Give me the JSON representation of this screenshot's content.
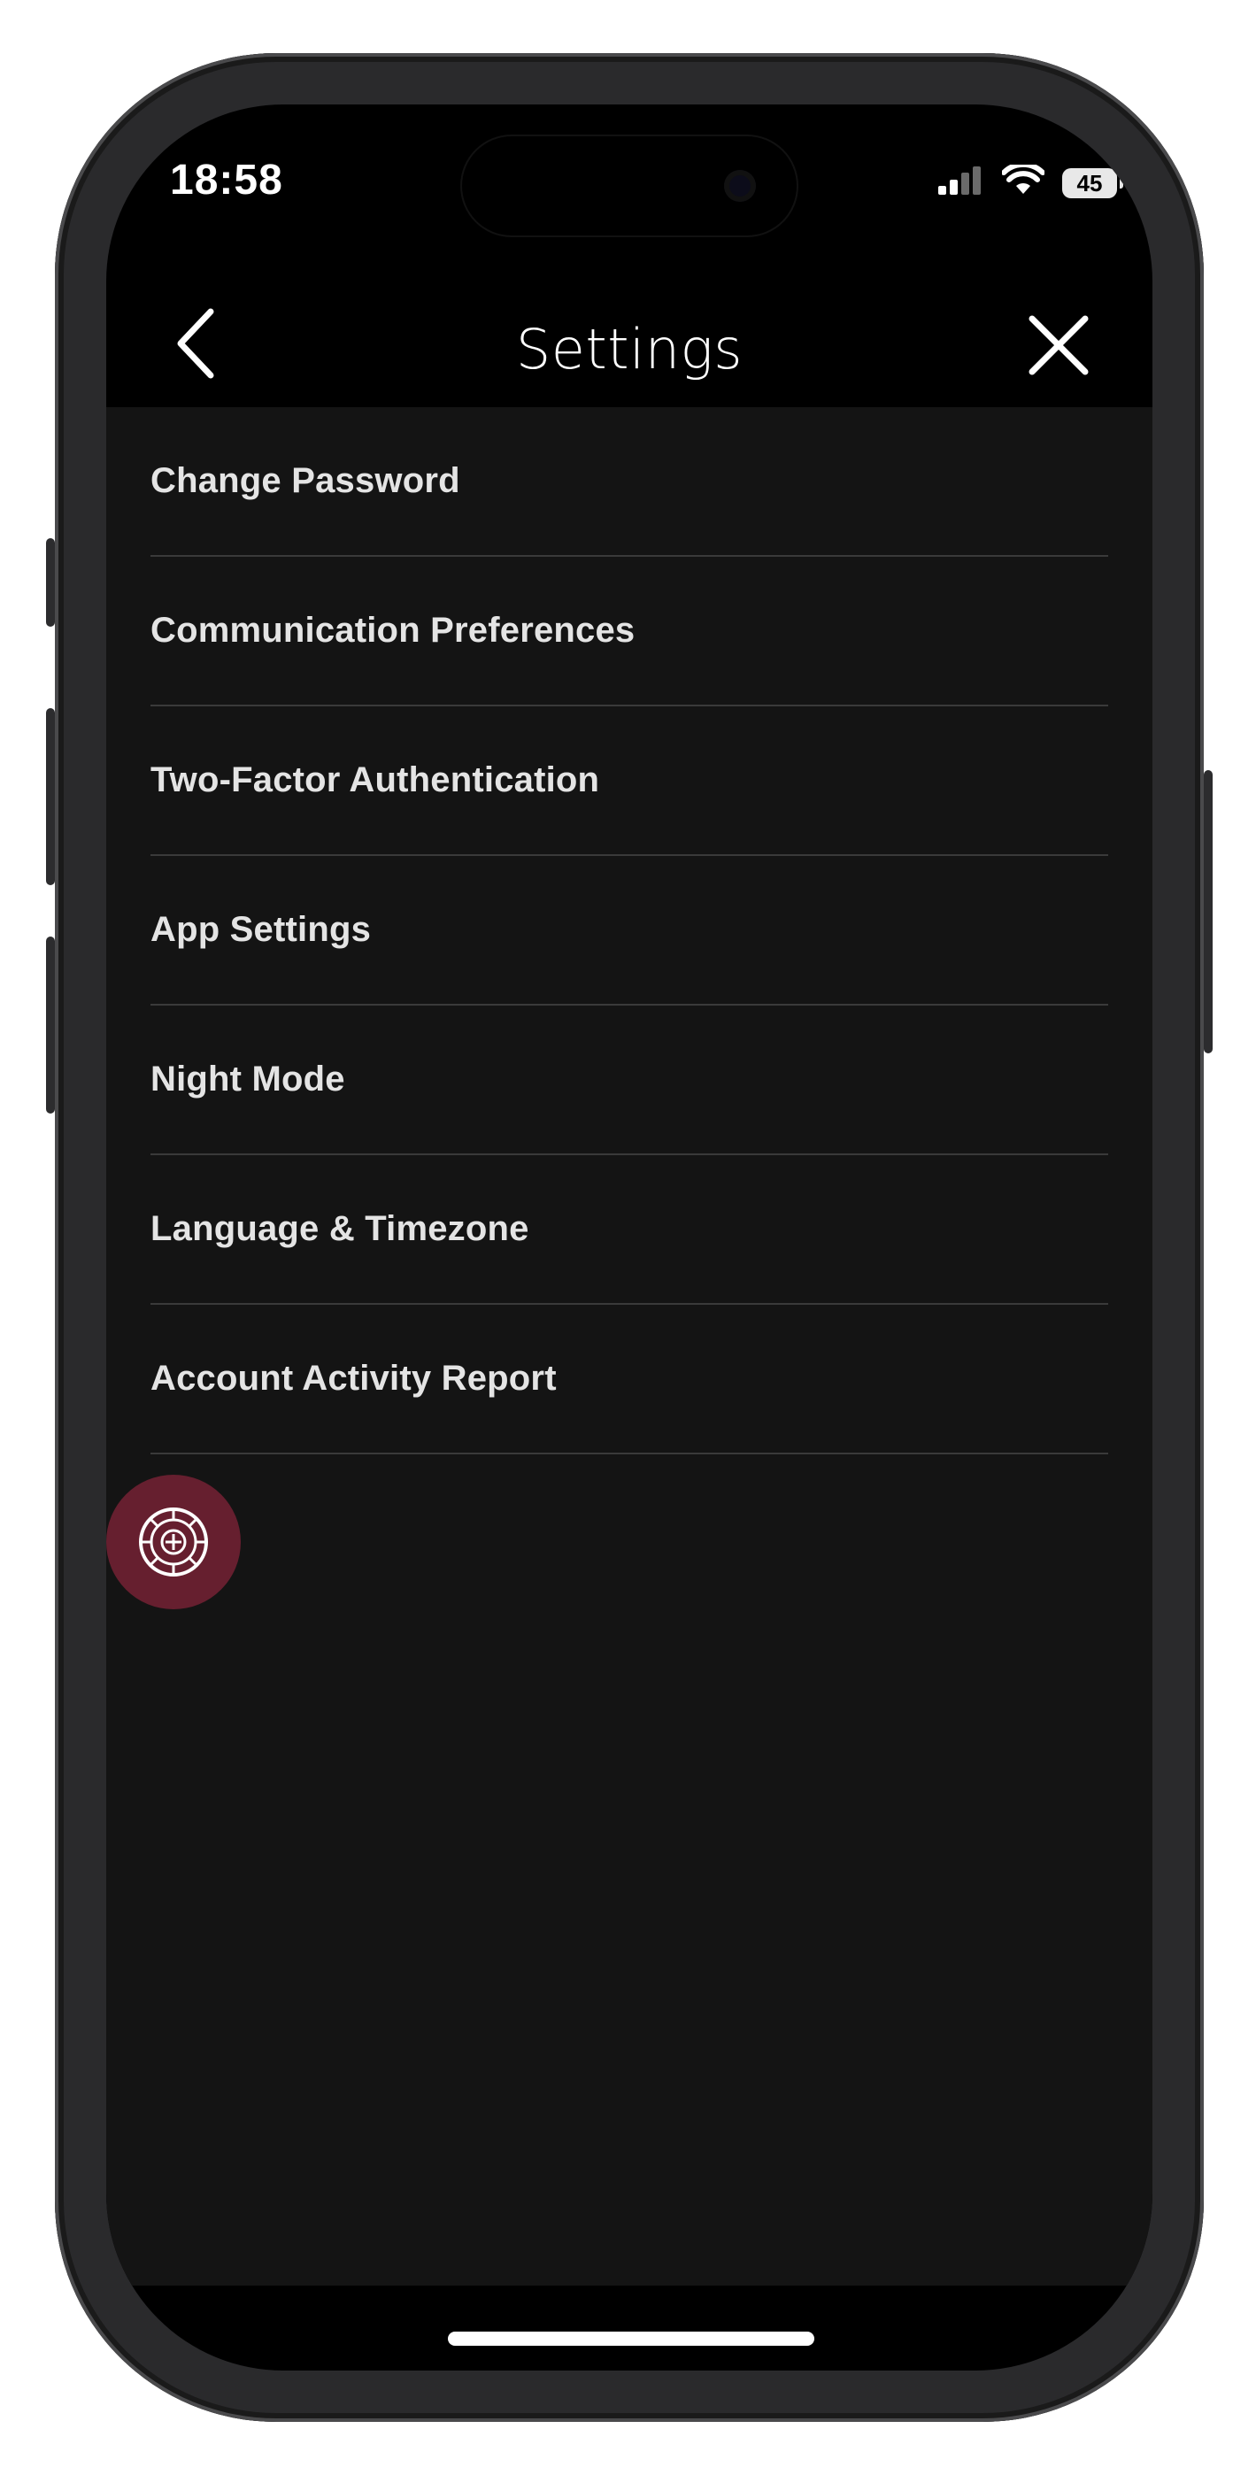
{
  "status_bar": {
    "time": "18:58",
    "battery": "45",
    "icons": [
      "cellular-signal-icon",
      "wifi-icon",
      "battery-icon"
    ]
  },
  "header": {
    "title": "Settings",
    "back_icon": "chevron-left-icon",
    "close_icon": "close-icon"
  },
  "settings": {
    "items": [
      {
        "label": "Change Password"
      },
      {
        "label": "Communication Preferences"
      },
      {
        "label": "Two-Factor Authentication"
      },
      {
        "label": "App Settings"
      },
      {
        "label": "Night Mode"
      },
      {
        "label": "Language & Timezone"
      },
      {
        "label": "Account Activity Report"
      }
    ]
  },
  "floating_button": {
    "icon": "roulette-wheel-icon"
  },
  "colors": {
    "background": "#000000",
    "panel": "#141414",
    "divider": "#3a3a3a",
    "text": "#e4e4e4",
    "accent": "#aa2846"
  }
}
